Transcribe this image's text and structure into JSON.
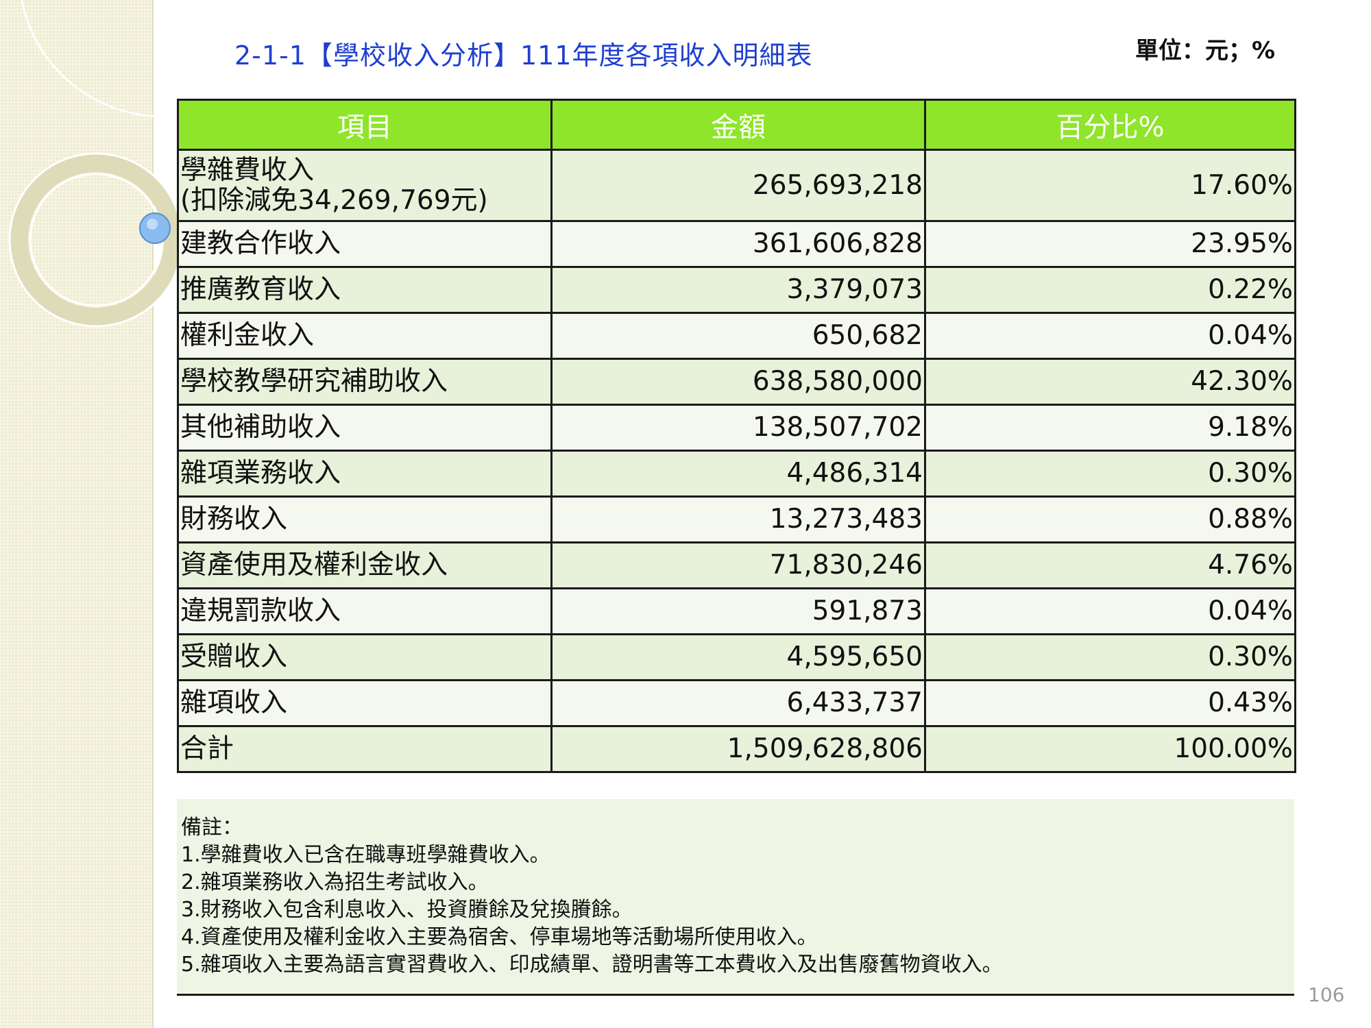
{
  "header": {
    "title": "2-1-1【學校收入分析】111年度各項收入明細表",
    "unit": "單位：元；%"
  },
  "table": {
    "columns": [
      "項目",
      "金額",
      "百分比%"
    ],
    "rows": [
      {
        "item": "學雜費收入",
        "item_sub": "(扣除減免34,269,769元)",
        "amount": "265,693,218",
        "percent": "17.60%"
      },
      {
        "item": "建教合作收入",
        "amount": "361,606,828",
        "percent": "23.95%"
      },
      {
        "item": "推廣教育收入",
        "amount": "3,379,073",
        "percent": "0.22%"
      },
      {
        "item": "權利金收入",
        "amount": "650,682",
        "percent": "0.04%"
      },
      {
        "item": "學校教學研究補助收入",
        "amount": "638,580,000",
        "percent": "42.30%"
      },
      {
        "item": "其他補助收入",
        "amount": "138,507,702",
        "percent": "9.18%"
      },
      {
        "item": "雜項業務收入",
        "amount": "4,486,314",
        "percent": "0.30%"
      },
      {
        "item": "財務收入",
        "amount": "13,273,483",
        "percent": "0.88%"
      },
      {
        "item": "資產使用及權利金收入",
        "amount": "71,830,246",
        "percent": "4.76%"
      },
      {
        "item": "違規罰款收入",
        "amount": "591,873",
        "percent": "0.04%"
      },
      {
        "item": "受贈收入",
        "amount": "4,595,650",
        "percent": "0.30%"
      },
      {
        "item": "雜項收入",
        "amount": "6,433,737",
        "percent": "0.43%"
      },
      {
        "item": "合計",
        "amount": "1,509,628,806",
        "percent": "100.00%"
      }
    ]
  },
  "notes": {
    "heading": "備註：",
    "items": [
      "1.學雜費收入已含在職專班學雜費收入。",
      "2.雜項業務收入為招生考試收入。",
      "3.財務收入包含利息收入、投資賸餘及兌換賸餘。",
      "4.資產使用及權利金收入主要為宿舍、停車場地等活動場所使用收入。",
      "5.雜項收入主要為語言實習費收入、印成績單、證明書等工本費收入及出售廢舊物資收入。"
    ]
  },
  "footer": {
    "page_number": "106"
  },
  "colors": {
    "title": "#1f3fd0",
    "header_fill": "#8ee52a",
    "row_odd": "#e8f1da",
    "row_even": "#f4f8ee",
    "side_band": "#eeecd0",
    "bullet_circle": "#7fb3ea"
  }
}
